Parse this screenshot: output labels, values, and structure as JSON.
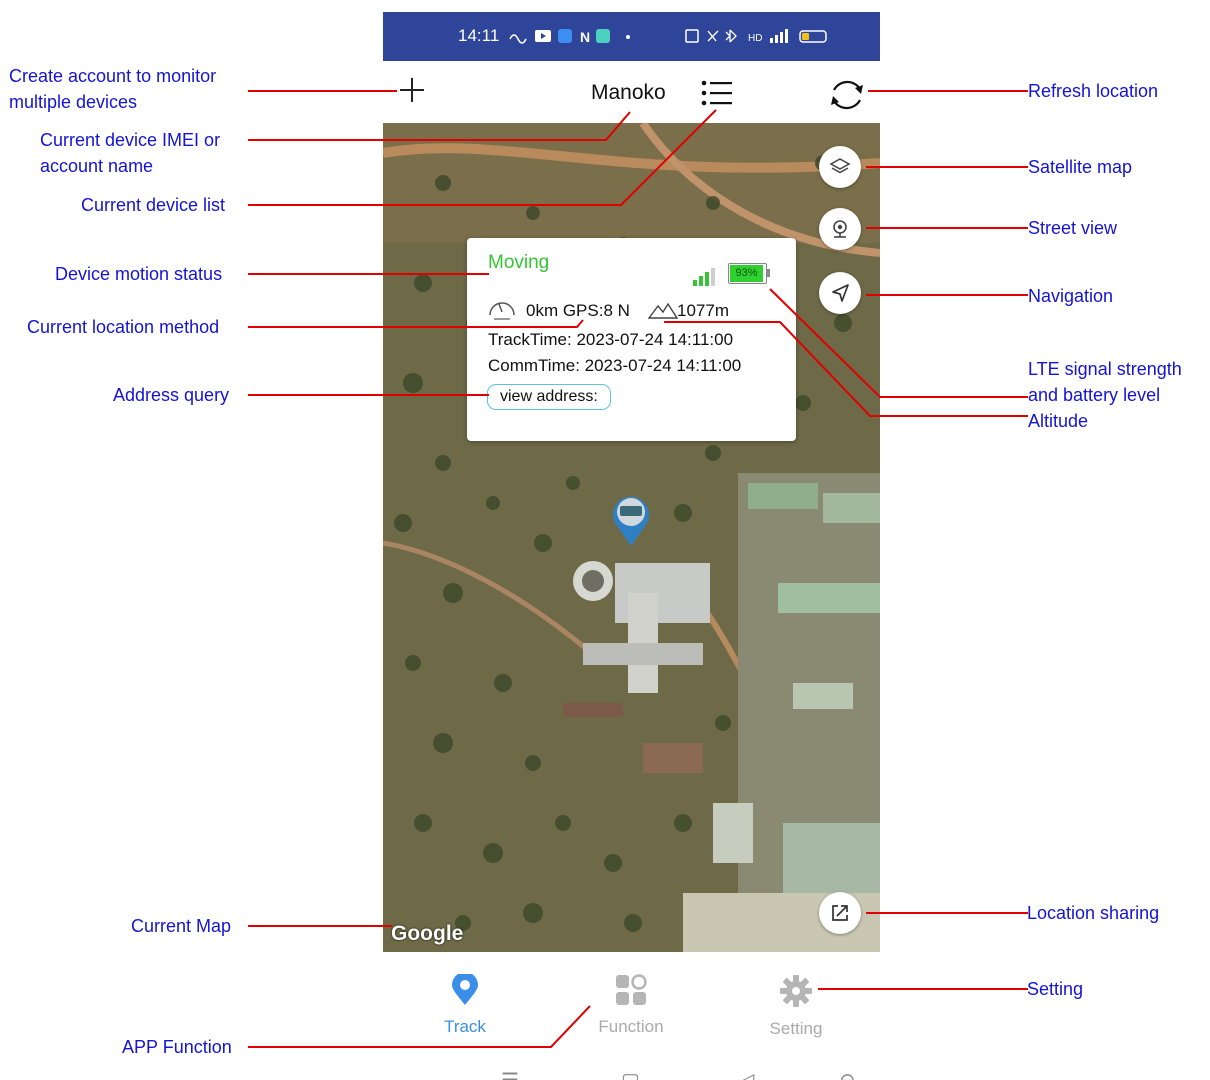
{
  "banner_text": "",
  "status_bar": {
    "time": "14:11"
  },
  "app_bar": {
    "device_name": "Manoko"
  },
  "info_card": {
    "motion_status": "Moving",
    "battery": "93%",
    "speed_line": "0km GPS:8 N",
    "altitude": "1077m",
    "track_time": "TrackTime: 2023-07-24 14:11:00",
    "comm_time": "CommTime: 2023-07-24 14:11:00",
    "view_address_label": "view address:"
  },
  "map": {
    "attribution": "Google"
  },
  "bottom_nav": {
    "items": [
      {
        "label": "Track",
        "icon": "location-pin-icon",
        "active": true
      },
      {
        "label": "Function",
        "icon": "grid-apps-icon",
        "active": false
      },
      {
        "label": "Setting",
        "icon": "gear-icon",
        "active": false
      }
    ]
  },
  "annotations": {
    "create_account": "Create account to monitor\nmultiple devices",
    "device_imei": "Current device IMEI or\naccount name",
    "device_list": "Current device list",
    "motion_status": "Device motion status",
    "location_method": "Current location method",
    "address_query": "Address query",
    "current_map": "Current Map",
    "app_function": "APP Function",
    "refresh_location": "Refresh location",
    "satellite_map": "Satellite map",
    "street_view": "Street view",
    "navigation": "Navigation",
    "lte_battery": "LTE signal strength\nand battery level",
    "altitude": "Altitude",
    "location_sharing": "Location sharing",
    "setting": "Setting"
  },
  "colors": {
    "status_bar": "#2f4599",
    "accent": "#3b8ee8",
    "moving_green": "#35c435",
    "annotation_blue": "#1414d6",
    "leader_red": "#e00000"
  }
}
